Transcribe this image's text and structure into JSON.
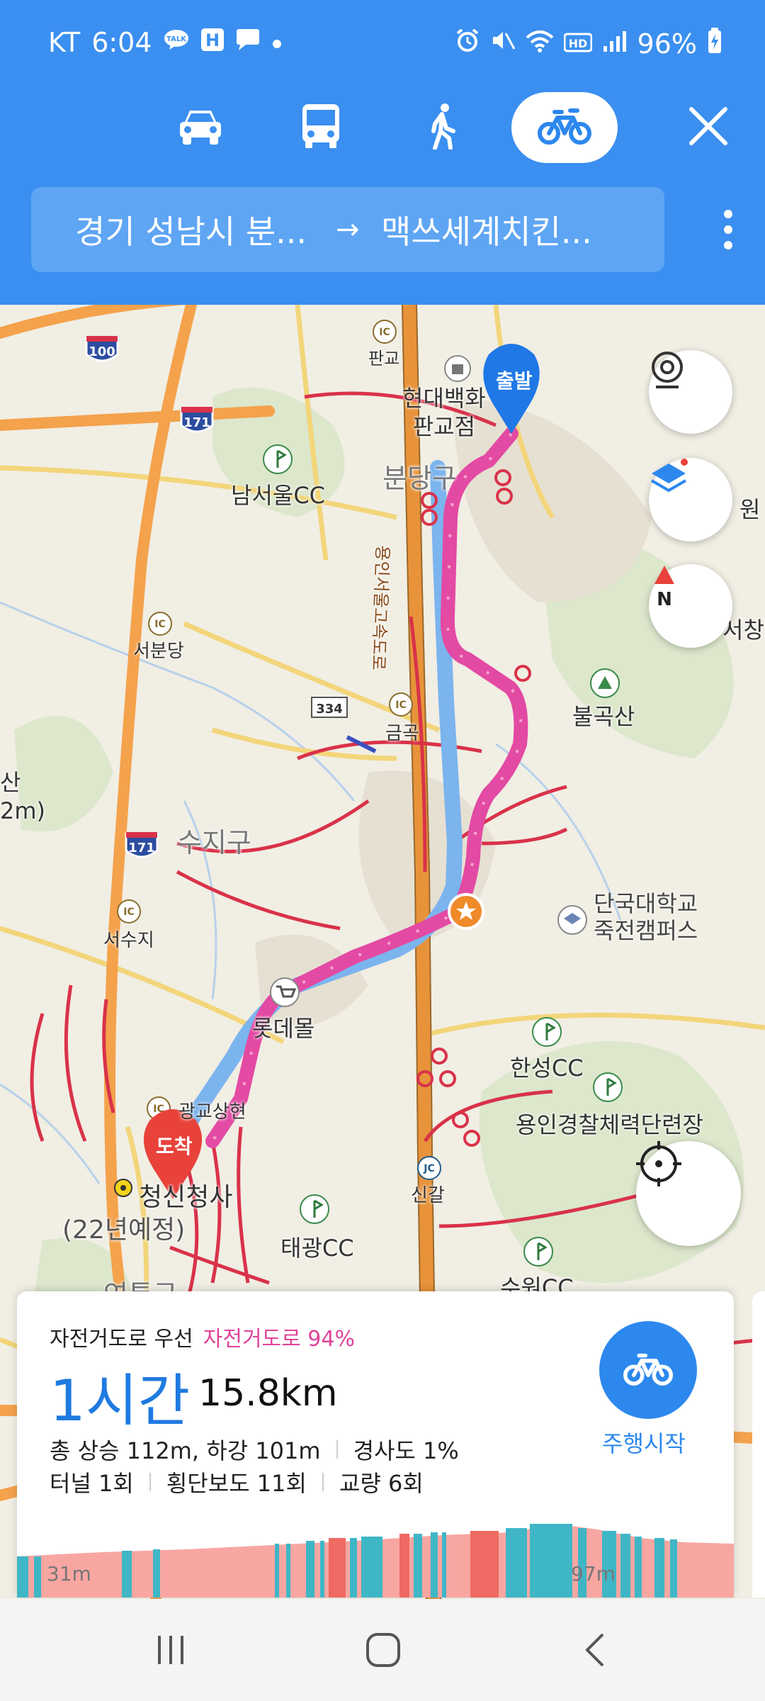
{
  "status_bar": {
    "carrier": "KT",
    "time": "6:04",
    "battery": "96%",
    "left_icons": [
      "talk-icon",
      "h-icon",
      "message-icon",
      "dot-icon"
    ],
    "right_icons": [
      "alarm-icon",
      "mute-icon",
      "wifi-icon",
      "hd-icon",
      "signal-icon",
      "battery-icon"
    ]
  },
  "modes": [
    {
      "name": "car",
      "icon": "car-icon",
      "active": false
    },
    {
      "name": "bus",
      "icon": "bus-icon",
      "active": false
    },
    {
      "name": "walk",
      "icon": "walk-icon",
      "active": false
    },
    {
      "name": "bicycle",
      "icon": "bicycle-icon",
      "active": true
    }
  ],
  "route": {
    "from": "경기 성남시 분...",
    "arrow": "→",
    "to": "맥쓰세계치킨..."
  },
  "map": {
    "labels": {
      "hyundai": "현대백화\n판교점",
      "pangyo_ic": "판교",
      "bundang": "분당구",
      "namseoul_cc": "남서울CC",
      "seobundang": "서분당",
      "geumgok": "금곡",
      "bulgoksan": "불곡산",
      "suji": "수지구",
      "seosuji": "서수지",
      "dankook": "단국대학교\n죽전캠퍼스",
      "lotte": "롯데몰",
      "hanseong_cc": "한성CC",
      "gwanggyo": "광교상현",
      "police": "용인경찰체력단련장",
      "cityhall": "청신청사",
      "cityhall_note": "(22년예정)",
      "taegwang_cc": "태광CC",
      "singal": "신갈",
      "suwon_cc": "수원CC",
      "jc": "JC",
      "ic": "IC",
      "right_edge_1": "원",
      "right_edge_2": "서창",
      "left_edge": "산\n2m)",
      "road_100": "100",
      "road_171": "171",
      "road_334": "334",
      "bottom_left": "연통구",
      "expressway": "용인서울고속도로"
    },
    "start_marker": "출발",
    "end_marker": "도착",
    "scale": "2km",
    "compass_letter": "N"
  },
  "card": {
    "preference": "자전거도로 우선",
    "bike_ratio": "자전거도로 94%",
    "duration": "1시간",
    "distance": "15.8km",
    "stats_line1": [
      "총 상승 112m, 하강 101m",
      "경사도 1%"
    ],
    "stats_line2": [
      "터널 1회",
      "횡단보도 11회",
      "교량 6회"
    ],
    "start_label": "주행시작",
    "elev_min": "31m",
    "elev_max": "97m"
  },
  "colors": {
    "header_blue": "#3a8ff0",
    "route_pink": "#e34aa3",
    "accent_blue": "#2d88ee"
  }
}
